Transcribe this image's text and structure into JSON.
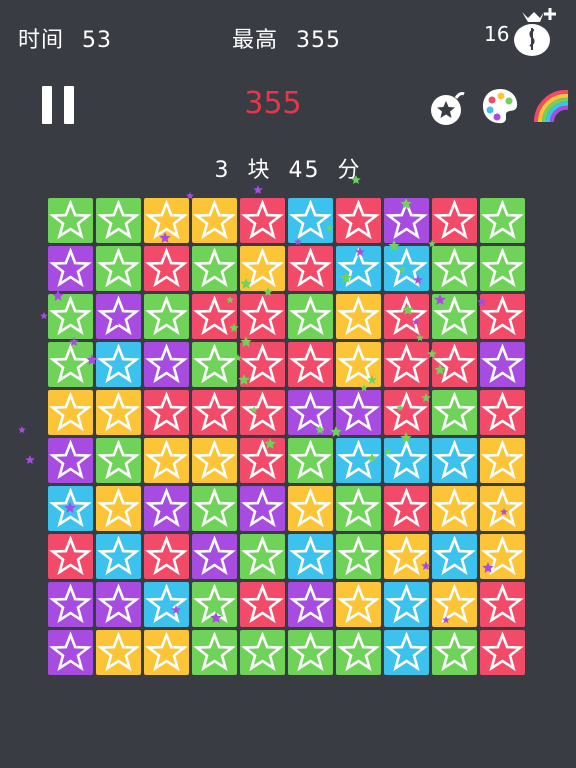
{
  "hud": {
    "time_label": "时间",
    "time_value": "53",
    "best_label": "最高",
    "best_value": "355",
    "coins": "16",
    "score": "355"
  },
  "status": {
    "blocks_count": "3",
    "blocks_word": "块",
    "points": "45",
    "points_word": "分"
  },
  "tools": [
    "star-bomb-icon",
    "palette-icon",
    "rainbow-icon"
  ],
  "colors": {
    "G": "#6fd35a",
    "P": "#a84be0",
    "Y": "#fbc537",
    "R": "#f24b6a",
    "B": "#3cc2ec"
  },
  "board": [
    [
      "G",
      "G",
      "Y",
      "Y",
      "R",
      "B",
      "R",
      "P",
      "R",
      "G"
    ],
    [
      "P",
      "G",
      "R",
      "G",
      "Y",
      "R",
      "B",
      "B",
      "G",
      "G"
    ],
    [
      "G",
      "P",
      "G",
      "R",
      "R",
      "G",
      "Y",
      "R",
      "G",
      "R"
    ],
    [
      "G",
      "B",
      "P",
      "G",
      "R",
      "R",
      "Y",
      "R",
      "R",
      "P"
    ],
    [
      "Y",
      "Y",
      "R",
      "R",
      "R",
      "P",
      "P",
      "R",
      "G",
      "R"
    ],
    [
      "P",
      "G",
      "Y",
      "Y",
      "R",
      "G",
      "B",
      "B",
      "B",
      "Y"
    ],
    [
      "B",
      "Y",
      "P",
      "G",
      "P",
      "Y",
      "G",
      "R",
      "Y",
      "Y"
    ],
    [
      "R",
      "B",
      "R",
      "P",
      "G",
      "B",
      "G",
      "Y",
      "B",
      "Y"
    ],
    [
      "P",
      "P",
      "B",
      "G",
      "R",
      "P",
      "Y",
      "B",
      "Y",
      "R"
    ],
    [
      "P",
      "Y",
      "Y",
      "G",
      "G",
      "G",
      "G",
      "B",
      "G",
      "R"
    ]
  ]
}
